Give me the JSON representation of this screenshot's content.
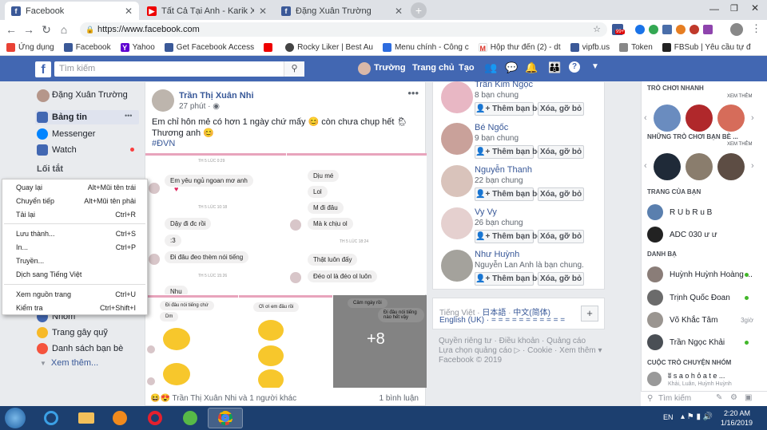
{
  "browser": {
    "tabs": [
      {
        "title": "Facebook",
        "active": true
      },
      {
        "title": "Tất Cả Tại Anh - Karik X Emma | C",
        "active": false
      },
      {
        "title": "Đặng Xuân Trường",
        "active": false
      }
    ],
    "url": "https://www.facebook.com",
    "bookmarks": [
      "Ứng dụng",
      "Facebook",
      "Yahoo",
      "Get Facebook Access",
      "Rocky Liker | Best Au",
      "Menu chính - Công c",
      "Hộp thư đến (2) - dt",
      "vipfb.us",
      "Token",
      "FBSub | Yêu cầu tự đ"
    ],
    "ext_badge": "99+"
  },
  "fb": {
    "search_placeholder": "Tìm kiếm",
    "user": "Trường",
    "home": "Trang chủ",
    "create": "Tạo"
  },
  "left_nav": {
    "profile": "Đặng Xuân Trường",
    "newsfeed": "Bảng tin",
    "more": "•••",
    "messenger": "Messenger",
    "watch": "Watch",
    "shortcuts": "Lối tắt",
    "groups": "Nhóm",
    "fundraisers": "Trang gây quỹ",
    "friend_lists": "Danh sách bạn bè",
    "see_more": "Xem thêm..."
  },
  "context_menu": [
    {
      "label": "Quay lại",
      "shortcut": "Alt+Mũi tên trái"
    },
    {
      "label": "Chuyển tiếp",
      "shortcut": "Alt+Mũi tên phải"
    },
    {
      "label": "Tải lại",
      "shortcut": "Ctrl+R"
    },
    {
      "label": "Lưu thành...",
      "shortcut": "Ctrl+S"
    },
    {
      "label": "In...",
      "shortcut": "Ctrl+P"
    },
    {
      "label": "Truyền...",
      "shortcut": ""
    },
    {
      "label": "Dịch sang Tiếng Việt",
      "shortcut": ""
    },
    {
      "label": "Xem nguồn trang",
      "shortcut": "Ctrl+U"
    },
    {
      "label": "Kiểm tra",
      "shortcut": "Ctrl+Shift+I"
    }
  ],
  "post": {
    "author": "Trần Thị Xuân Nhi",
    "time": "27 phút",
    "text1": "Em chỉ hôn mẻ có hơn 1 ngày chứ mấy 😊 còn chưa chụp hết 🌦",
    "text2": "Thương anh 😊",
    "hashtag": "#ĐVN",
    "chat1": {
      "ts1": "TH 5 LÚC 0:29",
      "m1": "Em yêu ngủ ngoan mơ anh",
      "ts2": "TH 5 LÚC 10:18",
      "m2": "Dậy đi đc rồi",
      "m3": ":3",
      "m4": "Đi đâu đeo thèm nói tiếng",
      "ts3": "TH 5 LÚC 15:26",
      "m5": "Nhu"
    },
    "chat2": {
      "m1": "Dịu mé",
      "m2": "Lol",
      "m3": "M đi đâu",
      "m4": "Mà k chịu ol",
      "ts1": "TH 5 LÚC 18:24",
      "m5": "Thật luôn đấy",
      "m6": "Đéo ol là đéo ol luôn"
    },
    "small1": {
      "m1": "Đi đâu nói tiếng chứ",
      "m2": "Dm"
    },
    "small2": {
      "m1": "Ơi ơi em đâu rồi"
    },
    "small3": {
      "m1": "Cảm ngày rồi",
      "m2": "Đi đâu nói tiếng nào hết vậy"
    },
    "more_photos": "+8",
    "reactions": "Trần Thị Xuân Nhi và 1 người khác",
    "comments": "1 bình luận"
  },
  "suggestions": [
    {
      "name": "Trần Kim Ngọc",
      "mutual": "8 bạn chung",
      "color": "#e8b7c4"
    },
    {
      "name": "Bé Ngốc",
      "mutual": "9 bạn chung",
      "color": "#c9a19a"
    },
    {
      "name": "Nguyễn Thanh",
      "mutual": "22 bạn chung",
      "color": "#d9c3bb"
    },
    {
      "name": "Vy Vy",
      "mutual": "26 bạn chung",
      "color": "#e5d0cf"
    },
    {
      "name": "Như Huỳnh",
      "mutual": "Nguyễn Lan Anh là bạn chung.",
      "color": "#a4a29c"
    }
  ],
  "suggestion_buttons": {
    "add": "Thêm bạn bè",
    "remove": "Xóa, gỡ bỏ"
  },
  "lang": {
    "vi": "Tiếng Việt",
    "ja": "日本語",
    "zh": "中文(简体)",
    "en": "English (UK)",
    "more": "= = = = = = = = = = =",
    "add": "+"
  },
  "footer": {
    "privacy": "Quyền riêng tư",
    "terms": "Điều khoản",
    "cookies": "Cookie",
    "ads": "Quảng cáo",
    "adchoices": "Lựa chọn quảng cáo ▷",
    "more": "Xem thêm ▾",
    "copyright": "Facebook © 2019"
  },
  "right": {
    "games_title": "TRÒ CHƠI NHANH",
    "see_more": "XEM THÊM",
    "games2_title": "NHỮNG TRÒ CHƠI BẠN BÈ ...",
    "see_more2": "XEM THÊM",
    "pages_title": "TRANG CỦA BẠN",
    "pages": [
      {
        "name": "R U b R u B",
        "color": "#5a7fae"
      },
      {
        "name": "ADC 030 ư ư",
        "color": "#222"
      }
    ],
    "contacts_title": "DANH BẠ",
    "contacts": [
      {
        "name": "Huỳnh Huỳnh Hoàng ...",
        "status": "",
        "color": "#8a7d78"
      },
      {
        "name": "Trịnh Quốc Đoan",
        "status": "",
        "color": "#6b6b6b"
      },
      {
        "name": "Võ Khắc Tâm",
        "status": "3giờ",
        "color": "#9a9590"
      },
      {
        "name": "Trần Ngọc Khải",
        "status": "",
        "color": "#4a4f55"
      }
    ],
    "group_chat_title": "CUỘC TRÒ CHUYỆN NHÓM",
    "group": {
      "name": "ʬ s a o h ỏ a  t e ...",
      "members": "Khải, Luân, Huỳnh Huỳnh"
    },
    "search": "Tìm kiếm"
  },
  "taskbar": {
    "lang": "EN",
    "time": "2:20 AM",
    "date": "1/16/2019"
  }
}
